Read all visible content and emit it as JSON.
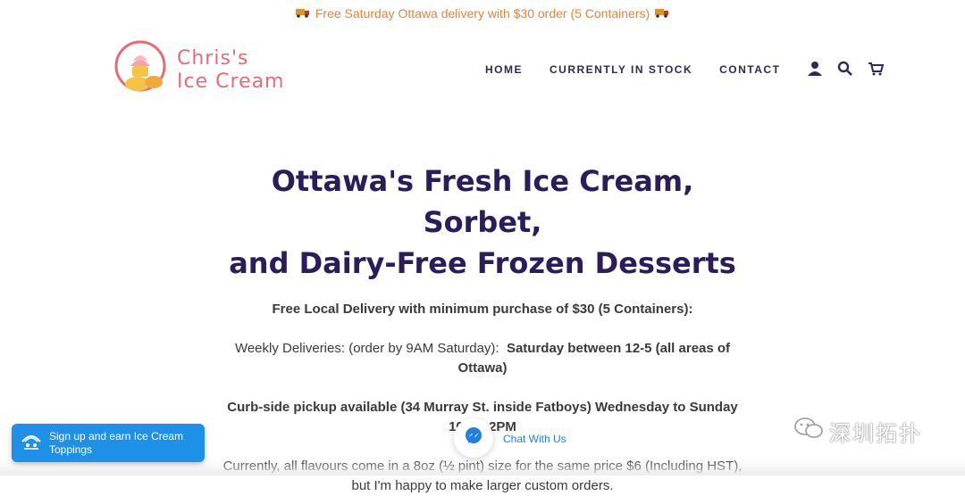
{
  "announcement": {
    "text": "Free Saturday Ottawa delivery with $30 order (5 Containers)"
  },
  "logo": {
    "line1": "Chris's",
    "line2": "Ice Cream"
  },
  "nav": {
    "items": [
      {
        "label": "HOME"
      },
      {
        "label": "CURRENTLY IN STOCK"
      },
      {
        "label": "CONTACT"
      }
    ],
    "icons": [
      "account-icon",
      "search-icon",
      "cart-icon"
    ]
  },
  "main": {
    "title_line1": "Ottawa's Fresh Ice Cream, Sorbet,",
    "title_line2": "and Dairy-Free Frozen Desserts",
    "delivery_heading": "Free Local Delivery with minimum purchase of $30 (5 Containers):",
    "weekly_prefix": "Weekly Deliveries: (order by 9AM Saturday):",
    "weekly_bold": "Saturday between 12-5 (all areas of Ottawa)",
    "pickup": "Curb-side pickup available (34 Murray St. inside Fatboys) Wednesday to Sunday 10AM-2PM",
    "flavours_text": "Currently, all flavours come in a 8oz (½ pint) size for the same price $6 (Including HST), but I'm happy to make larger custom orders."
  },
  "signup_widget": {
    "label": "Sign up and earn Ice Cream Toppings"
  },
  "chat_widget": {
    "label": "Chat With Us"
  },
  "watermark": {
    "text": "深圳拓扑"
  },
  "colors": {
    "announcement": "#e8833a",
    "logo": "#e46c78",
    "nav": "#2e2a55",
    "title": "#2c1c5c",
    "signup_bg": "#1e90e8",
    "chat_label": "#1e80e0"
  }
}
